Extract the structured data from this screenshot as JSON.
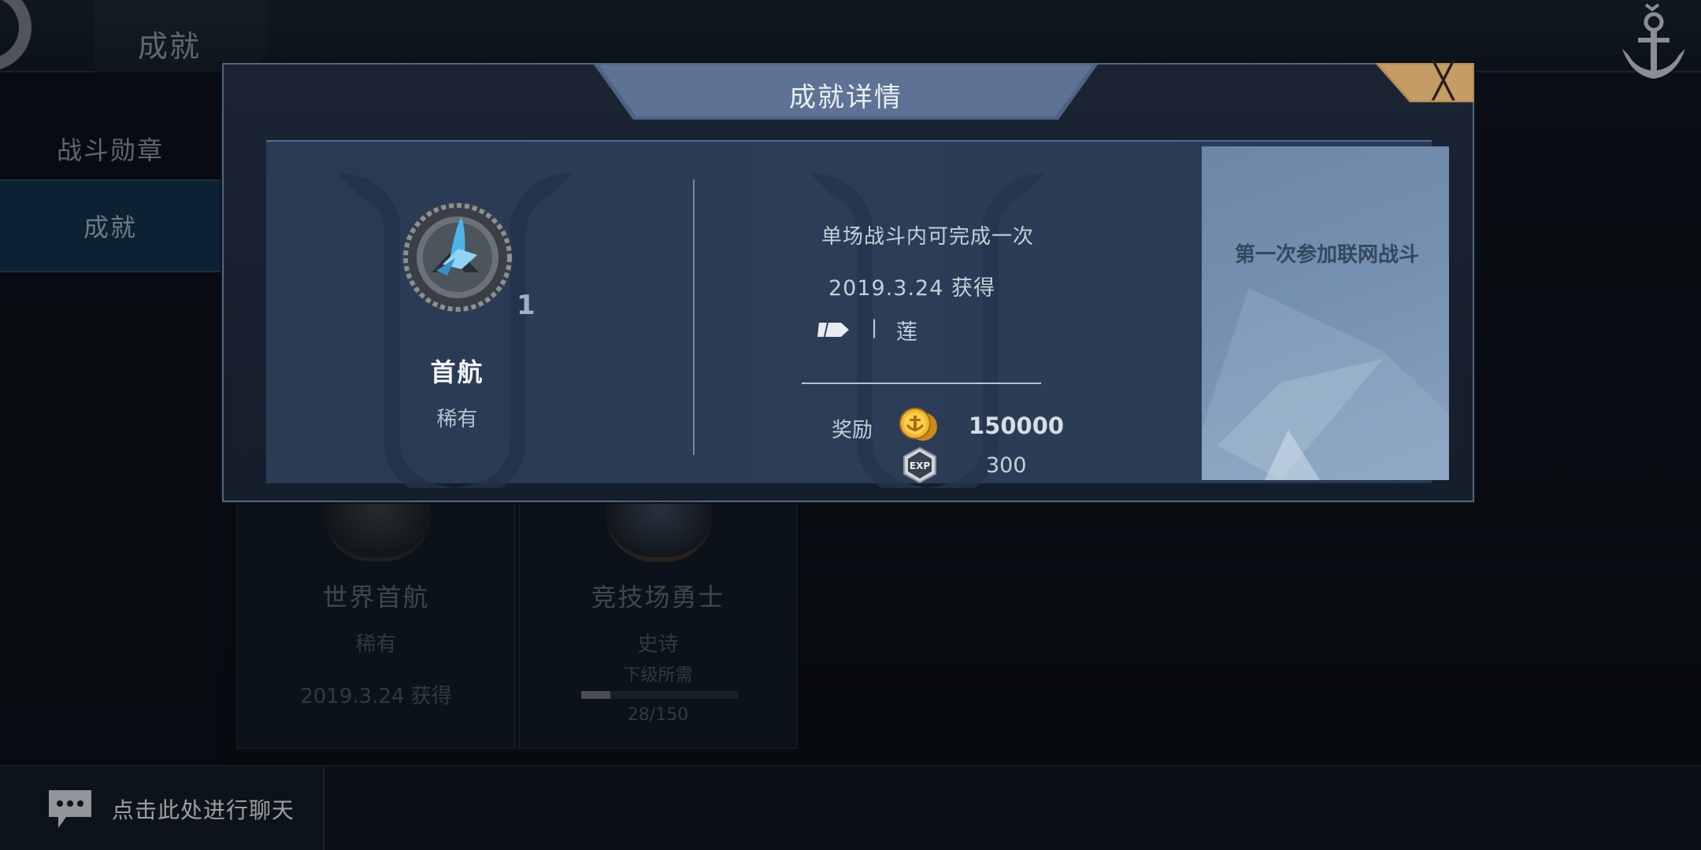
{
  "header": {
    "title": "成就"
  },
  "sidebar": {
    "items": [
      {
        "label": "战斗勋章"
      },
      {
        "label": "成就"
      }
    ]
  },
  "cards": [
    {
      "name": "世界首航",
      "rarity": "稀有",
      "date": "2019.3.24 获得"
    },
    {
      "name": "竞技场勇士",
      "rarity": "史诗",
      "next_label": "下级所需",
      "progress": "28/150",
      "progress_fraction": 0.187
    }
  ],
  "chat": {
    "label": "点击此处进行聊天"
  },
  "modal": {
    "title": "成就详情",
    "close_glyph": "╳",
    "achievement": {
      "name": "首航",
      "rarity": "稀有",
      "count": "1",
      "description": "单场战斗内可完成一次",
      "date": "2019.3.24 获得",
      "separator": "|",
      "ship_name": "莲",
      "reward_label": "奖励",
      "coin_amount": "150000",
      "exp_amount": "300",
      "condition": "第一次参加联网战斗"
    }
  },
  "icons": {
    "medal": "medal-icon",
    "coin": "anchor-coin-icon",
    "exp": "exp-icon",
    "chat": "chat-bubble-icon",
    "logo": "anchor-logo-icon",
    "close": "close-icon"
  },
  "colors": {
    "accent": "#133149",
    "close_tab": "#b48a58",
    "modal_border": "#55667a"
  }
}
